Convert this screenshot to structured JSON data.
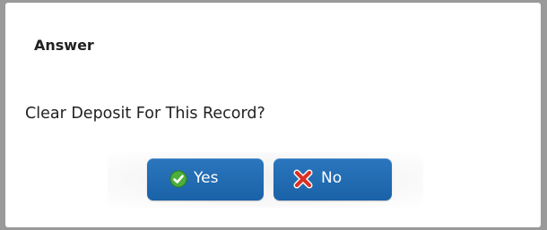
{
  "dialog": {
    "title": "Answer",
    "message": "Clear Deposit For This Record?",
    "buttons": {
      "yes_label": "Yes",
      "no_label": "No"
    },
    "icons": {
      "yes": "check-icon",
      "no": "x-icon"
    },
    "colors": {
      "button": "#1f69b0",
      "check": "#4caf3a",
      "x": "#d93025"
    }
  }
}
